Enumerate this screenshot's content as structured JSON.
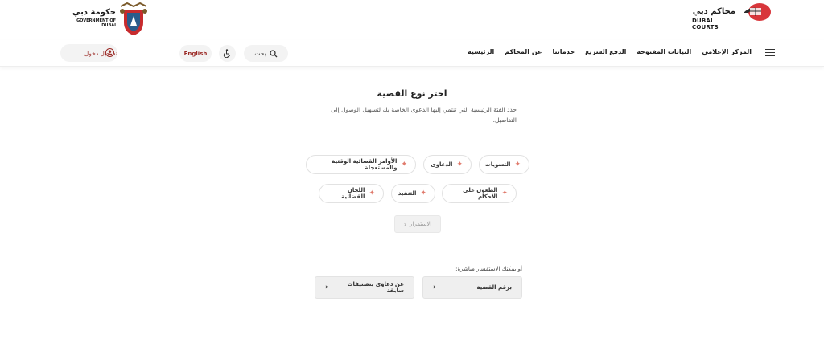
{
  "header": {
    "courts_logo": {
      "title": "محاكم دبي",
      "subtitle": "DUBAI COURTS"
    },
    "gov_logo": {
      "title": "حكومة دبي",
      "subtitle": "GOVERNMENT OF DUBAI"
    }
  },
  "nav": {
    "items": [
      {
        "label": "الرئيسية"
      },
      {
        "label": "عن المحاكم"
      },
      {
        "label": "خدماتنا"
      },
      {
        "label": "الدفع السريع"
      },
      {
        "label": "البيانات المفتوحة"
      },
      {
        "label": "المركز الإعلامي"
      }
    ],
    "search_label": "بحث",
    "language_label": "English",
    "login_label": "تسجيل دخول"
  },
  "main": {
    "title": "اختر نوع القضية",
    "description": "حدد الفئة الرئيسية التي تنتمي إليها الدعوى الخاصة بك لتسهيل الوصول إلى التفاصيل.",
    "categories": [
      {
        "label": "التسويات"
      },
      {
        "label": "الدعاوى"
      },
      {
        "label": "الأوامر القضائية الوقتية والمستعجلة"
      },
      {
        "label": "الطعون على الأحكام"
      },
      {
        "label": "التنفيذ"
      },
      {
        "label": "اللجان القضائية"
      }
    ],
    "continue_label": "الاستمرار",
    "alt_prompt": "أو يمكنك الاستفسار مباشرة:",
    "alt_buttons": [
      {
        "label": "برقم القضية"
      },
      {
        "label": "عن دعاوي بتصنيفات سابقة"
      }
    ]
  },
  "colors": {
    "accent": "#9b2a26",
    "star": "#e07a6c"
  }
}
